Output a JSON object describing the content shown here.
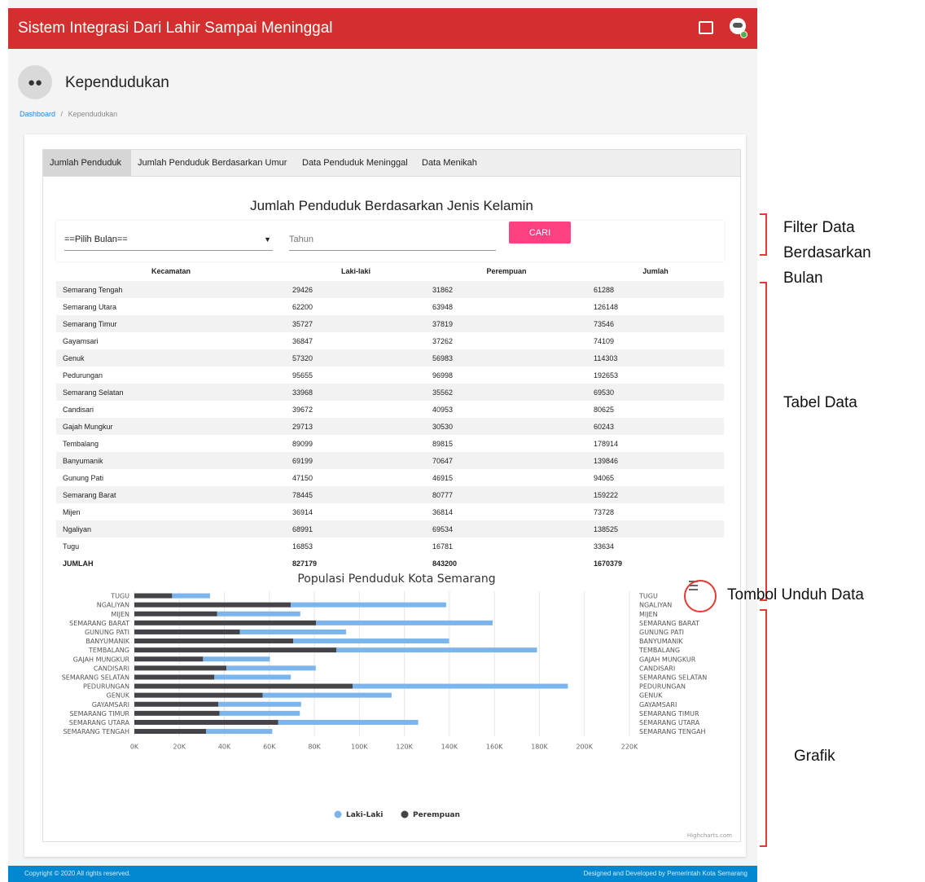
{
  "header": {
    "title": "Sistem Integrasi Dari Lahir Sampai Meninggal"
  },
  "page": {
    "title": "Kependudukan",
    "breadcrumb": {
      "home": "Dashboard",
      "sep": "/",
      "current": "Kependudukan"
    }
  },
  "tabs": [
    "Jumlah Penduduk",
    "Jumlah Penduduk Berdasarkan Umur",
    "Data Penduduk Meninggal",
    "Data Menikah"
  ],
  "section_title": "Jumlah Penduduk Berdasarkan Jenis Kelamin",
  "filter": {
    "month_select": "==Pilih Bulan==",
    "year_placeholder": "Tahun",
    "search_button": "CARI"
  },
  "table": {
    "headers": [
      "Kecamatan",
      "Laki-laki",
      "Perempuan",
      "Jumlah"
    ],
    "rows": [
      [
        "Semarang Tengah",
        "29426",
        "31862",
        "61288"
      ],
      [
        "Semarang Utara",
        "62200",
        "63948",
        "126148"
      ],
      [
        "Semarang Timur",
        "35727",
        "37819",
        "73546"
      ],
      [
        "Gayamsari",
        "36847",
        "37262",
        "74109"
      ],
      [
        "Genuk",
        "57320",
        "56983",
        "114303"
      ],
      [
        "Pedurungan",
        "95655",
        "96998",
        "192653"
      ],
      [
        "Semarang Selatan",
        "33968",
        "35562",
        "69530"
      ],
      [
        "Candisari",
        "39672",
        "40953",
        "80625"
      ],
      [
        "Gajah Mungkur",
        "29713",
        "30530",
        "60243"
      ],
      [
        "Tembalang",
        "89099",
        "89815",
        "178914"
      ],
      [
        "Banyumanik",
        "69199",
        "70647",
        "139846"
      ],
      [
        "Gunung Pati",
        "47150",
        "46915",
        "94065"
      ],
      [
        "Semarang Barat",
        "78445",
        "80777",
        "159222"
      ],
      [
        "Mijen",
        "36914",
        "36814",
        "73728"
      ],
      [
        "Ngaliyan",
        "68991",
        "69534",
        "138525"
      ],
      [
        "Tugu",
        "16853",
        "16781",
        "33634"
      ]
    ],
    "total": [
      "JUMLAH",
      "827179",
      "843200",
      "1670379"
    ]
  },
  "chart_data": {
    "type": "bar",
    "stacked": true,
    "orientation": "horizontal",
    "title": "Populasi Penduduk Kota Semarang",
    "categories": [
      "TUGU",
      "NGALIYAN",
      "MIJEN",
      "SEMARANG BARAT",
      "GUNUNG PATI",
      "BANYUMANIK",
      "TEMBALANG",
      "GAJAH MUNGKUR",
      "CANDISARI",
      "SEMARANG SELATAN",
      "PEDURUNGAN",
      "GENUK",
      "GAYAMSARI",
      "SEMARANG TIMUR",
      "SEMARANG UTARA",
      "SEMARANG TENGAH"
    ],
    "series": [
      {
        "name": "Laki-Laki",
        "color": "#7cb5ec",
        "values": [
          16853,
          68991,
          36914,
          78445,
          47150,
          69199,
          89099,
          29713,
          39672,
          33968,
          95655,
          57320,
          36847,
          35727,
          62200,
          29426
        ]
      },
      {
        "name": "Perempuan",
        "color": "#434348",
        "values": [
          16781,
          69534,
          36814,
          80777,
          46915,
          70647,
          89815,
          30530,
          40953,
          35562,
          96998,
          56983,
          37262,
          37819,
          63948,
          31862
        ]
      }
    ],
    "xticks": [
      "0K",
      "20K",
      "40K",
      "60K",
      "80K",
      "100K",
      "120K",
      "140K",
      "160K",
      "180K",
      "200K",
      "220K"
    ],
    "xlim": [
      0,
      220000
    ],
    "grid": true,
    "legend_position": "bottom",
    "credits": "Highcharts.com"
  },
  "annotations": {
    "filter": [
      "Filter Data",
      "Berdasarkan",
      "Bulan"
    ],
    "table": "Tabel Data",
    "download": "Tombol Unduh Data",
    "chart": "Grafik",
    "color": "#e53935"
  },
  "footer": {
    "copyright": "Copyright © 2020 All rights reserved.",
    "credit": "Designed and Developed by Pemerintah Kota Semarang"
  }
}
